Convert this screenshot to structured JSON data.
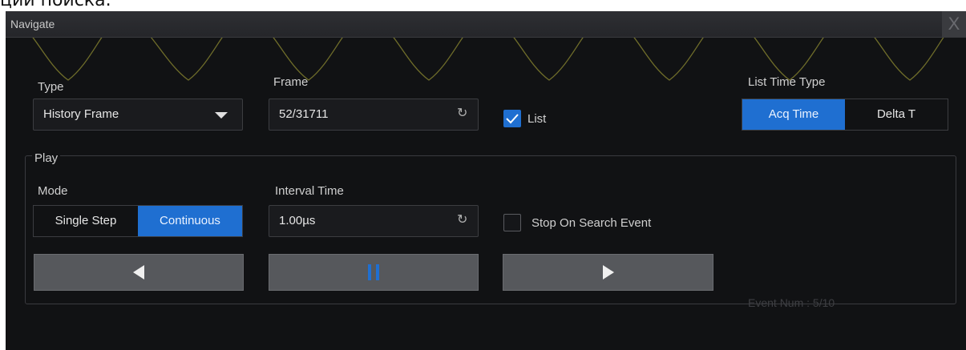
{
  "caption_fragment": "ции поиска.",
  "window": {
    "title": "Navigate",
    "close_label": "X"
  },
  "type": {
    "label": "Type",
    "value": "History Frame"
  },
  "frame": {
    "label": "Frame",
    "value": "52/31711"
  },
  "list": {
    "label": "List",
    "checked": true
  },
  "list_time_type": {
    "label": "List Time Type",
    "options": [
      "Acq Time",
      "Delta T"
    ],
    "selected": "Acq Time"
  },
  "play": {
    "group_label": "Play",
    "mode": {
      "label": "Mode",
      "options": [
        "Single Step",
        "Continuous"
      ],
      "selected": "Continuous"
    },
    "interval": {
      "label": "Interval Time",
      "value": "1.00µs"
    },
    "stop_on_search": {
      "label": "Stop On Search Event",
      "checked": false
    },
    "controls": [
      "previous-icon",
      "pause-icon",
      "next-icon"
    ]
  },
  "event_num": "Event Num : 5/10",
  "colors": {
    "accent": "#1f6fd1",
    "background": "#111214",
    "trace": "#6f6d2a"
  }
}
